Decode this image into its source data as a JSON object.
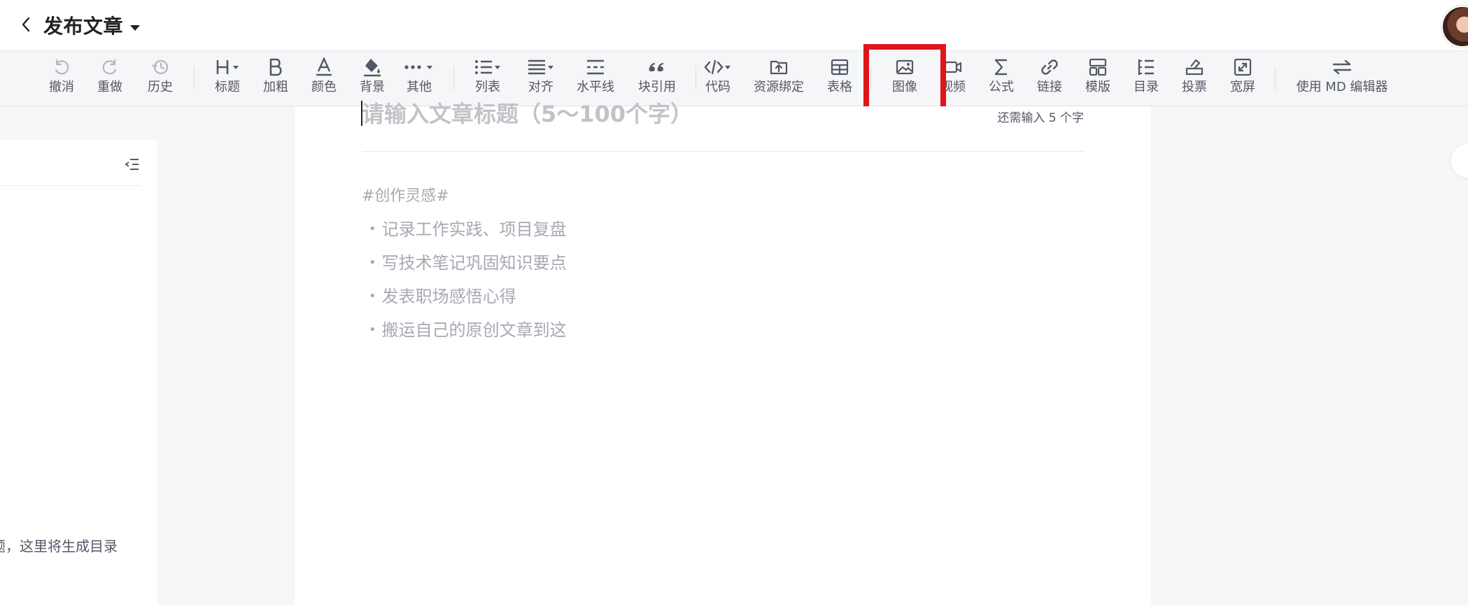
{
  "header": {
    "title": "发布文章",
    "back_icon": "chevron-left-icon",
    "dropdown_icon": "caret-down-icon"
  },
  "toolbar": {
    "undo": "撤消",
    "redo": "重做",
    "history": "历史",
    "heading": "标题",
    "bold": "加粗",
    "color": "颜色",
    "background": "背景",
    "other": "其他",
    "list": "列表",
    "align": "对齐",
    "hr": "水平线",
    "blockquote": "块引用",
    "code": "代码",
    "resource": "资源绑定",
    "table": "表格",
    "image": "图像",
    "video": "视频",
    "formula": "公式",
    "link": "链接",
    "template": "模版",
    "toc": "目录",
    "vote": "投票",
    "fullscreen": "宽屏",
    "md_editor": "使用 MD 编辑器"
  },
  "sidebar": {
    "toc_hint": "题，这里将生成目录"
  },
  "editor": {
    "title_placeholder": "请输入文章标题（5～100个字）",
    "char_hint": "还需输入 5 个字",
    "inspiration_tag": "#创作灵感#",
    "inspiration_items": [
      "记录工作实践、项目复盘",
      "写技术笔记巩固知识要点",
      "发表职场感悟心得",
      "搬运自己的原创文章到这"
    ],
    "bullet": "•"
  },
  "colors": {
    "highlight": "#e0141b",
    "toolbar_bg": "#f5f6f7",
    "icon": "#555666",
    "placeholder": "#a8a8b3"
  }
}
